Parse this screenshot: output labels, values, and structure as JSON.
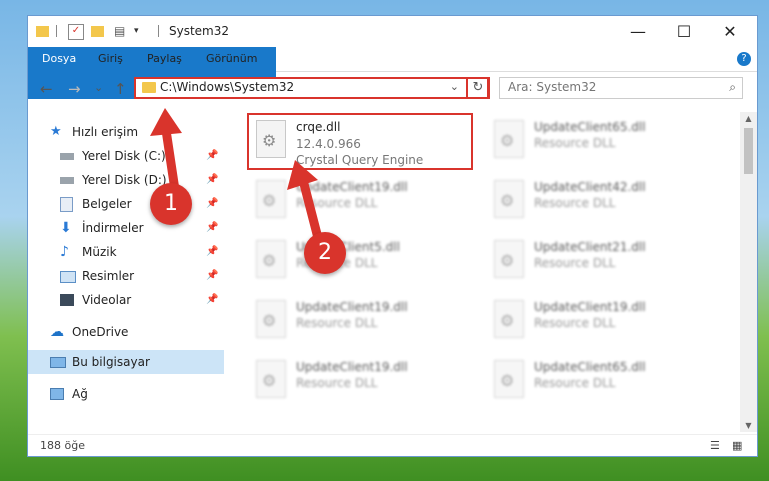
{
  "window": {
    "title": "System32",
    "controls": {
      "minimize": "—",
      "maximize": "☐",
      "close": "✕"
    }
  },
  "ribbon": {
    "tabs": [
      "Dosya",
      "Giriş",
      "Paylaş",
      "Görünüm"
    ],
    "help": "?"
  },
  "nav": {
    "back": "←",
    "forward": "→",
    "recent": "⌄",
    "up": "↑",
    "address": "C:\\Windows\\System32",
    "address_dropdown": "⌄",
    "refresh": "↻",
    "search_placeholder": "Ara: System32",
    "search_icon": "search-icon"
  },
  "sidebar": {
    "items": [
      {
        "label": "Hızlı erişim",
        "icon": "star-icon"
      },
      {
        "label": "Yerel Disk (C:)",
        "icon": "drive-icon",
        "pinned": "📌"
      },
      {
        "label": "Yerel Disk (D:)",
        "icon": "drive-icon",
        "pinned": "📌"
      },
      {
        "label": "Belgeler",
        "icon": "documents-icon",
        "pinned": "📌"
      },
      {
        "label": "İndirmeler",
        "icon": "download-icon",
        "pinned": "📌"
      },
      {
        "label": "Müzik",
        "icon": "music-icon",
        "pinned": "📌"
      },
      {
        "label": "Resimler",
        "icon": "pictures-icon",
        "pinned": "📌"
      },
      {
        "label": "Videolar",
        "icon": "videos-icon",
        "pinned": "📌"
      },
      {
        "label": "OneDrive",
        "icon": "cloud-icon"
      },
      {
        "label": "Bu bilgisayar",
        "icon": "computer-icon"
      },
      {
        "label": "Ağ",
        "icon": "network-icon"
      }
    ]
  },
  "files": [
    {
      "name": "crqe.dll",
      "version": "12.4.0.966",
      "desc": "Crystal Query Engine"
    },
    {
      "name": "UpdateClient65.dll",
      "version": "",
      "desc": "Resource DLL"
    },
    {
      "name": "UpdateClient19.dll",
      "version": "",
      "desc": "Resource DLL"
    },
    {
      "name": "UpdateClient42.dll",
      "version": "",
      "desc": "Resource DLL"
    },
    {
      "name": "UpdateClient5.dll",
      "version": "",
      "desc": "Resource DLL"
    },
    {
      "name": "UpdateClient21.dll",
      "version": "",
      "desc": "Resource DLL"
    },
    {
      "name": "UpdateClient19.dll",
      "version": "",
      "desc": "Resource DLL"
    },
    {
      "name": "UpdateClient19.dll",
      "version": "",
      "desc": "Resource DLL"
    },
    {
      "name": "UpdateClient19.dll",
      "version": "",
      "desc": "Resource DLL"
    },
    {
      "name": "UpdateClient65.dll",
      "version": "",
      "desc": "Resource DLL"
    }
  ],
  "status": {
    "count": "188 öğe"
  },
  "annotations": {
    "step1": "1",
    "step2": "2",
    "color": "#d9342c"
  }
}
